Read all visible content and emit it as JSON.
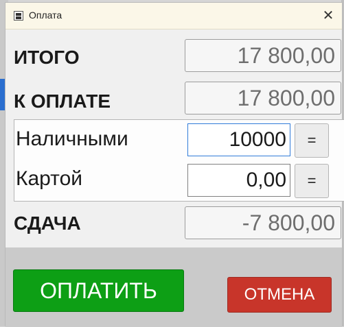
{
  "window": {
    "title": "Оплата",
    "close_glyph": "✕",
    "icon": "calculator-icon"
  },
  "total": {
    "label": "ИТОГО",
    "value": "17 800,00"
  },
  "to_pay": {
    "label": "К ОПЛАТЕ",
    "value": "17 800,00"
  },
  "cash": {
    "label": "Наличными",
    "value": "10000",
    "eq_label": "="
  },
  "card": {
    "label": "Картой",
    "value": "0,00",
    "eq_label": "="
  },
  "change": {
    "label": "СДАЧА",
    "value": "-7 800,00"
  },
  "buttons": {
    "pay": "ОПЛАТИТЬ",
    "cancel": "ОТМЕНА"
  },
  "colors": {
    "pay_button": "#0d9f15",
    "cancel_button": "#c8352a",
    "focus_border": "#2f7bd9",
    "titlebar": "#fbf7e8"
  }
}
